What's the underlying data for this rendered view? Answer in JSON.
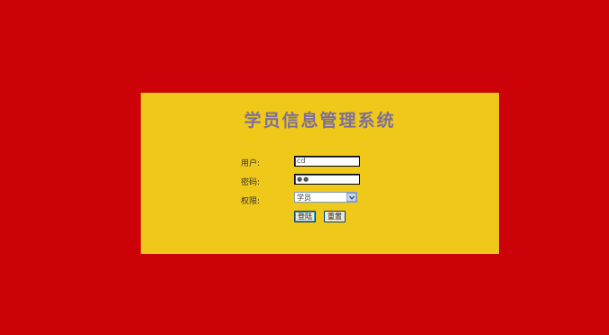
{
  "app": {
    "title": "学员信息管理系统"
  },
  "form": {
    "user_label": "用户:",
    "user_value": "cd",
    "password_label": "密码:",
    "password_value": "●●",
    "role_label": "权限:",
    "role_selected": "学员",
    "login_label": "登陆",
    "reset_label": "重置"
  },
  "colors": {
    "background": "#cd0209",
    "panel": "#f0c81a",
    "title": "#7d6f9a"
  },
  "icons": {
    "role_dropdown": "chevron-down-icon"
  }
}
